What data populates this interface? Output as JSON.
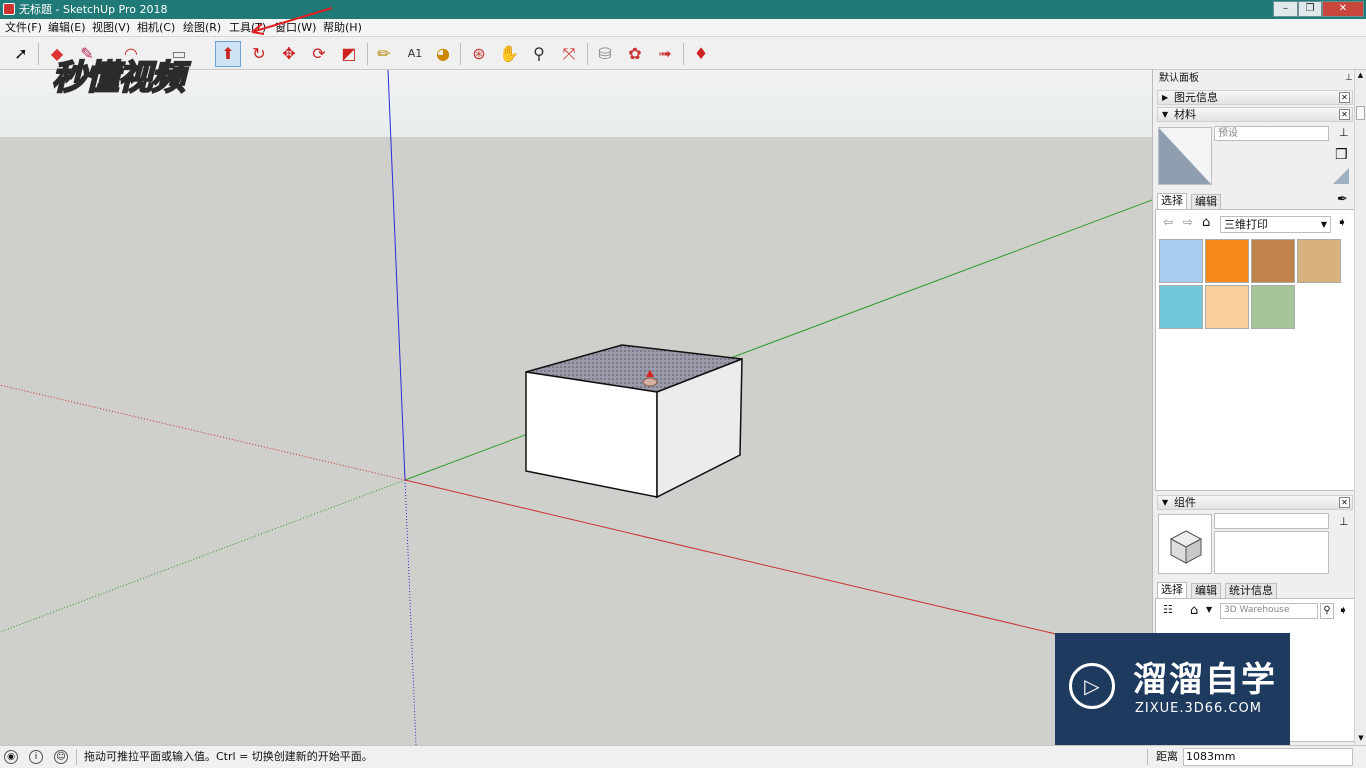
{
  "window": {
    "title": "无标题 - SketchUp Pro 2018",
    "minimize": "–",
    "maximize": "❐",
    "close": "✕"
  },
  "menu": [
    "文件(F)",
    "编辑(E)",
    "视图(V)",
    "相机(C)",
    "绘图(R)",
    "工具(T)",
    "窗口(W)",
    "帮助(H)"
  ],
  "brand_watermark": "秒懂视频",
  "toolbar": {
    "icons": [
      "select-icon",
      "eraser-icon",
      "pencil-icon",
      "arc-icon",
      "rectangle-icon",
      "push-pull-icon",
      "follow-me-icon",
      "move-icon",
      "rotate-icon",
      "scale-icon",
      "tape-measure-icon",
      "text-icon",
      "paint-bucket-icon",
      "orbit-icon",
      "pan-icon",
      "zoom-icon",
      "zoom-extents-icon",
      "warehouse-icon",
      "extension-warehouse-icon",
      "send-to-layout-icon",
      "ruby-icon"
    ]
  },
  "tray": {
    "title": "默认面板",
    "entity_info": "图元信息",
    "materials": {
      "header": "材料",
      "name_placeholder": "预设",
      "tab_select": "选择",
      "tab_edit": "编辑",
      "library": "三维打印",
      "swatch_colors": [
        "#a9cdf0",
        "#f6891a",
        "#c0834a",
        "#d8b27c",
        "#6fc9da",
        "#f8cf98",
        "#a6c49a"
      ]
    },
    "components": {
      "header": "组件",
      "tab_select": "选择",
      "tab_edit": "编辑",
      "tab_stats": "统计信息",
      "search_placeholder": "3D Warehouse"
    }
  },
  "status": {
    "hint": "拖动可推拉平面或输入值。Ctrl = 切换创建新的开始平面。",
    "measure_label": "距离",
    "measure_value": "1083mm"
  },
  "site_watermark": {
    "name": "溜溜自学",
    "url": "ZIXUE.3D66.COM"
  }
}
